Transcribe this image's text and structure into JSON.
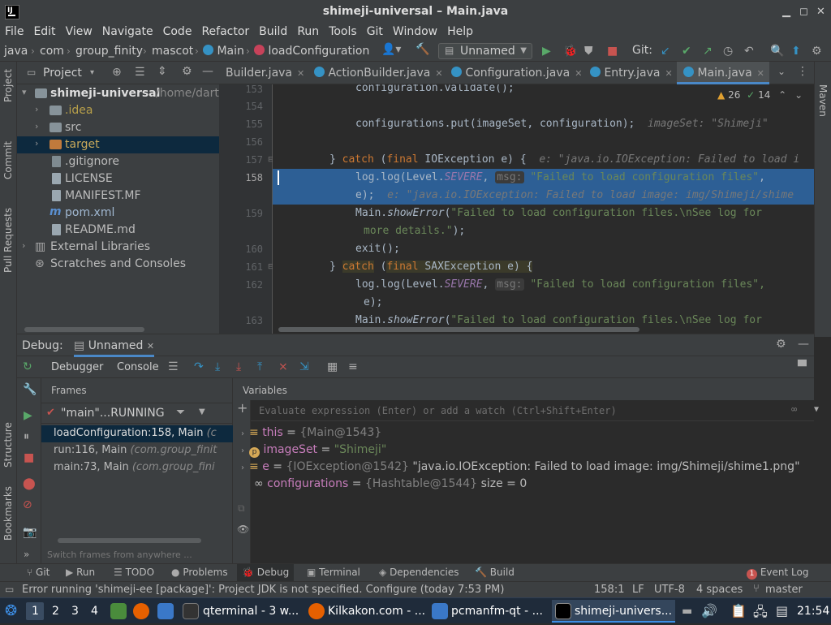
{
  "window": {
    "title": "shimeji-universal – Main.java"
  },
  "menu": [
    "File",
    "Edit",
    "View",
    "Navigate",
    "Code",
    "Refactor",
    "Build",
    "Run",
    "Tools",
    "Git",
    "Window",
    "Help"
  ],
  "breadcrumb": [
    "java",
    "com",
    "group_finity",
    "mascot",
    "Main",
    "loadConfiguration"
  ],
  "run_config": "Unnamed",
  "git_label": "Git:",
  "project": {
    "header": "Project",
    "root": "shimeji-universal",
    "root_path": "/home/dartz",
    "items": [
      ".idea",
      "src",
      "target",
      ".gitignore",
      "LICENSE",
      "MANIFEST.MF",
      "pom.xml",
      "README.md",
      "External Libraries",
      "Scratches and Consoles"
    ]
  },
  "left_stripe": [
    "Project",
    "Commit",
    "Pull Requests",
    "Structure",
    "Bookmarks"
  ],
  "right_stripe": [
    "Maven"
  ],
  "tabs": [
    "Builder.java",
    "ActionBuilder.java",
    "Configuration.java",
    "Entry.java",
    "Main.java"
  ],
  "inspections": {
    "warnings": "26",
    "weak": "14"
  },
  "code": {
    "line_numbers": [
      "153",
      "154",
      "155",
      "156",
      "157",
      "158",
      "",
      "159",
      "",
      "160",
      "161",
      "162",
      "",
      "163"
    ],
    "lines": {
      "l153": "configuration.validate();",
      "l155a": "configurations.put(imageSet, configuration);",
      "l155hint": "imageSet: \"Shimeji\"",
      "l157a": "} ",
      "l157kw1": "catch",
      "l157b": " (",
      "l157kw2": "final",
      "l157c": " IOException e) {",
      "l157hint": "e: \"java.io.IOException: Failed to load i",
      "l158a": "log.log(Level.",
      "l158b": "SEVERE",
      "l158c": ", ",
      "l158hint": "msg:",
      "l158str": "\"Failed to load configuration files\"",
      "l158d": ", ",
      "l158e": "e);",
      "l158hint2": "e: \"java.io.IOException: Failed to load image: img/Shimeji/shime",
      "l159a": "Main.",
      "l159b": "showError",
      "l159c": "(",
      "l159str": "\"Failed to load configuration files.\\nSee log for",
      "l159str2": "more details.\"",
      "l159d": ");",
      "l160": "exit();",
      "l161a": "} ",
      "l161kw1": "catch",
      "l161b": " (",
      "l161kw2": "final",
      "l161c": " SAXException e) {",
      "l162a": "log.log(Level.",
      "l162b": "SEVERE",
      "l162c": ", ",
      "l162hint": "msg:",
      "l162str": "\"Failed to load configuration files\",",
      "l162d": "e);",
      "l163a": "Main.",
      "l163b": "showError",
      "l163c": "(",
      "l163str": "\"Failed to load configuration files.\\nSee log for"
    }
  },
  "debug": {
    "title": "Debug:",
    "session": "Unnamed",
    "tabs": [
      "Debugger",
      "Console"
    ],
    "frames_label": "Frames",
    "variables_label": "Variables",
    "thread": "\"main\"...RUNNING",
    "frames": [
      {
        "method": "loadConfiguration:158, Main",
        "cls": "(c"
      },
      {
        "method": "run:116, Main",
        "cls": "(com.group_finit"
      },
      {
        "method": "main:73, Main",
        "cls": "(com.group_fini"
      }
    ],
    "switch_hint": "Switch frames from anywhere ...",
    "eval_placeholder": "Evaluate expression (Enter) or add a watch (Ctrl+Shift+Enter)",
    "variables": [
      {
        "name": "this",
        "eq": " = ",
        "type": "{Main@1543}",
        "value": ""
      },
      {
        "name": "imageSet",
        "eq": " = ",
        "type": "",
        "value": "\"Shimeji\""
      },
      {
        "name": "e",
        "eq": " = ",
        "type": "{IOException@1542}",
        "value": " \"java.io.IOException: Failed to load image: img/Shimeji/shime1.png\""
      },
      {
        "name": "configurations",
        "eq": " = ",
        "type": "{Hashtable@1544}",
        "value": "  size = 0"
      }
    ]
  },
  "toolwindows": [
    "Git",
    "Run",
    "TODO",
    "Problems",
    "Debug",
    "Terminal",
    "Dependencies",
    "Build"
  ],
  "event_log": {
    "count": "1",
    "label": "Event Log"
  },
  "status": {
    "message": "Error running 'shimeji-ee [package]': Project JDK is not specified. Configure (today 7:53 PM)",
    "pos": "158:1",
    "eol": "LF",
    "enc": "UTF-8",
    "indent": "4 spaces",
    "branch": "master"
  },
  "taskbar": {
    "workspaces": [
      "1",
      "2",
      "3",
      "4"
    ],
    "apps": [
      "qterminal - 3 w...",
      "Kilkakon.com - ...",
      "pcmanfm-qt - ...",
      "shimeji-univers..."
    ],
    "clock": "21:54"
  }
}
